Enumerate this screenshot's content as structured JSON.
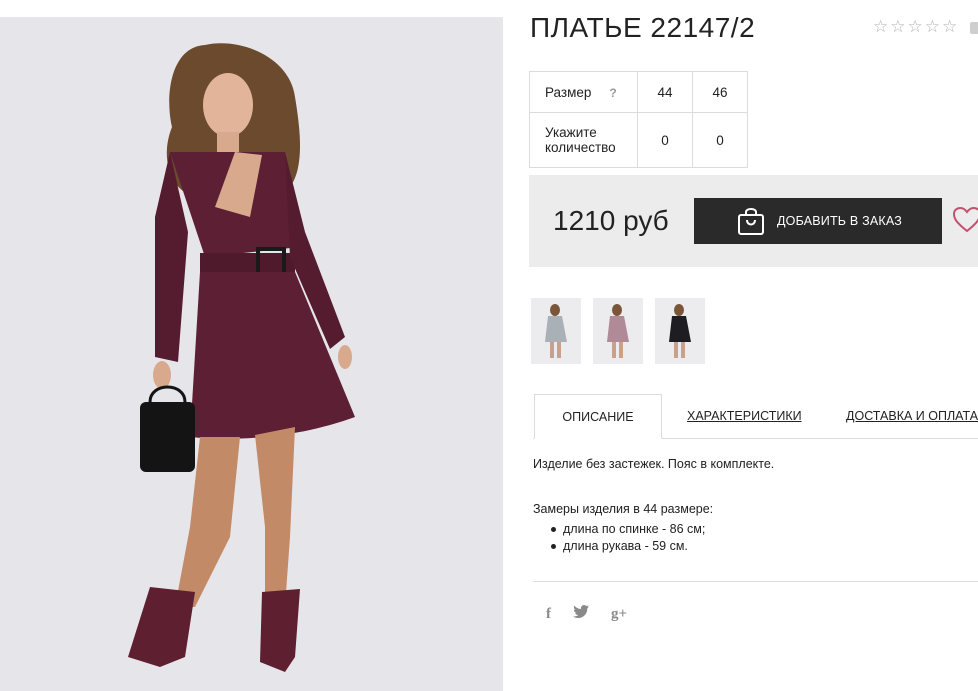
{
  "product": {
    "title": "ПЛАТЬЕ 22147/2",
    "rating_stars": 5,
    "rating_filled": 0
  },
  "size_table": {
    "size_label": "Размер",
    "help_symbol": "?",
    "sizes": [
      "44",
      "46"
    ],
    "quantity_label_line1": "Укажите",
    "quantity_label_line2": "количество",
    "quantities": [
      "0",
      "0"
    ]
  },
  "buy": {
    "price": "1210 руб",
    "add_label": "ДОБАВИТЬ В ЗАКАЗ"
  },
  "thumbnails": [
    {
      "name": "thumb-grey-dress",
      "color": "#a9b1b7"
    },
    {
      "name": "thumb-mauve-dress",
      "color": "#b08a96"
    },
    {
      "name": "thumb-black-dress",
      "color": "#1e1e22"
    }
  ],
  "tabs": [
    {
      "label": "ОПИСАНИЕ",
      "active": true
    },
    {
      "label": "ХАРАКТЕРИСТИКИ",
      "active": false
    },
    {
      "label": "ДОСТАВКА И ОПЛАТА",
      "active": false
    }
  ],
  "description": {
    "text": "Изделие без застежек. Пояс в комплекте.",
    "measurements_title": "Замеры изделия в 44 размере:",
    "measurements": [
      "длина по спинке - 86 см;",
      "длина рукава - 59 см."
    ]
  },
  "social": {
    "facebook": "f",
    "twitter": "t",
    "google_plus": "g+"
  },
  "colors": {
    "dress": "#5c1f33",
    "button": "#2a2a2a",
    "favorite": "#c5506e"
  }
}
